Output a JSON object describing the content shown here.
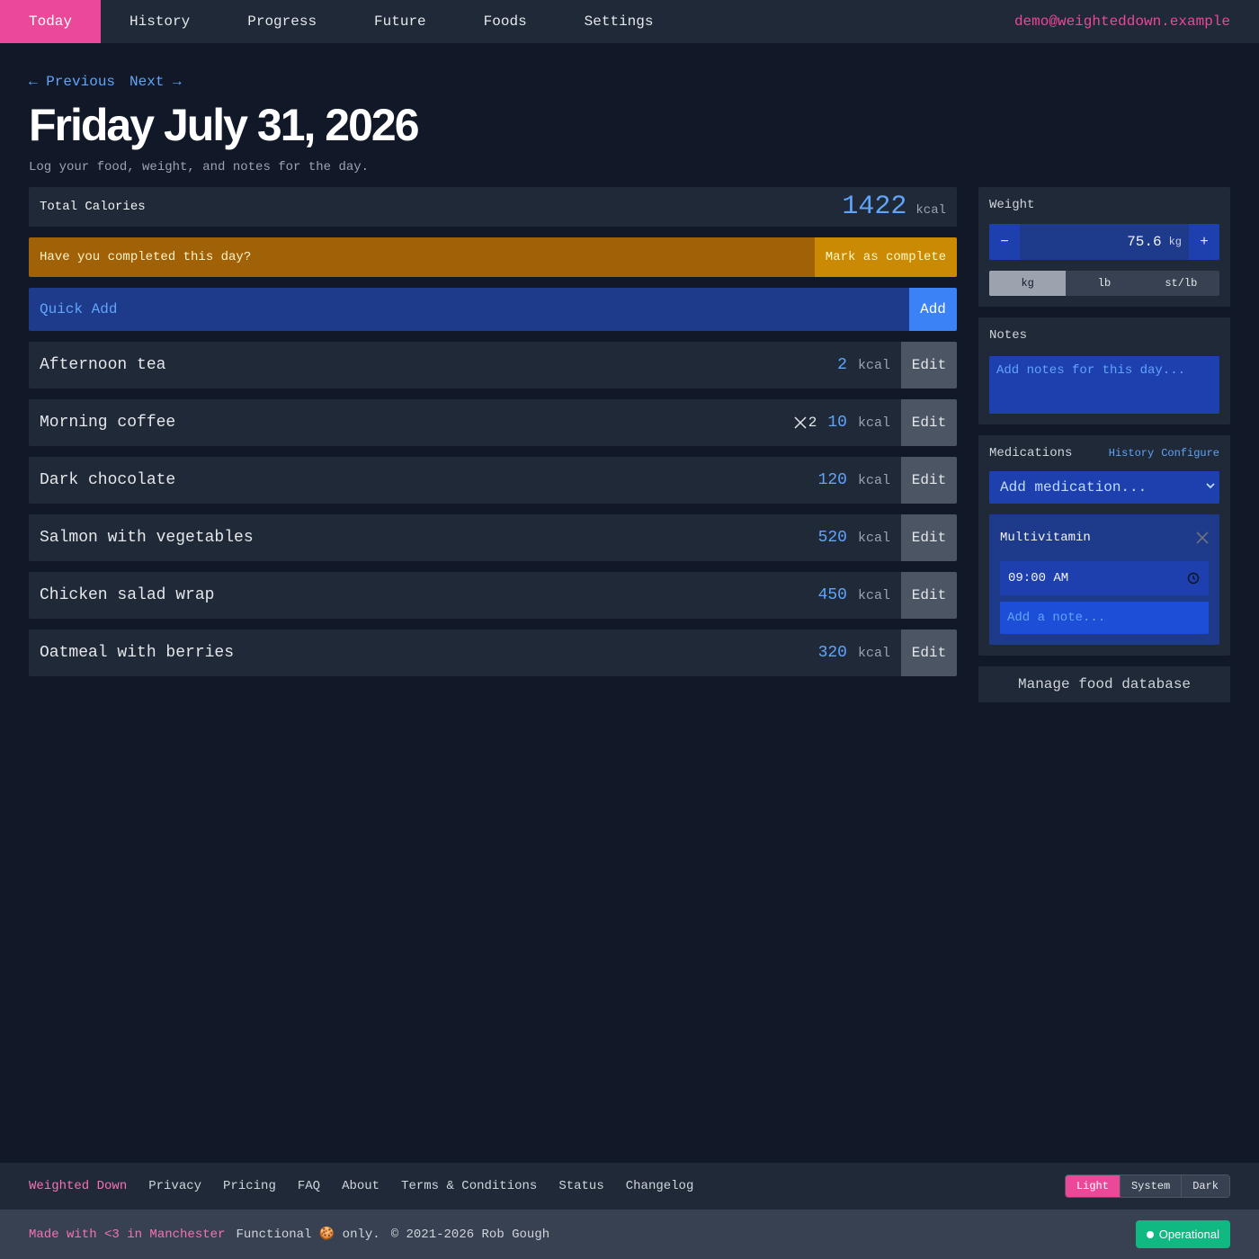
{
  "nav": {
    "items": [
      {
        "label": "Today",
        "active": true
      },
      {
        "label": "History",
        "active": false
      },
      {
        "label": "Progress",
        "active": false
      },
      {
        "label": "Future",
        "active": false
      },
      {
        "label": "Foods",
        "active": false
      },
      {
        "label": "Settings",
        "active": false
      }
    ],
    "user_email": "demo@weighteddown.example"
  },
  "date_nav": {
    "previous": "← Previous",
    "next": "Next →"
  },
  "page": {
    "title": "Friday July 31, 2026",
    "subtitle": "Log your food, weight, and notes for the day."
  },
  "total": {
    "label": "Total Calories",
    "value": "1422",
    "unit": "kcal"
  },
  "complete": {
    "question": "Have you completed this day?",
    "button": "Mark as complete"
  },
  "quick_add": {
    "placeholder": "Quick Add",
    "button": "Add"
  },
  "foods": [
    {
      "name": "Afternoon tea",
      "quantity": "",
      "kcal": "2",
      "unit": "kcal",
      "edit": "Edit"
    },
    {
      "name": "Morning coffee",
      "quantity": "2",
      "kcal": "10",
      "unit": "kcal",
      "edit": "Edit"
    },
    {
      "name": "Dark chocolate",
      "quantity": "",
      "kcal": "120",
      "unit": "kcal",
      "edit": "Edit"
    },
    {
      "name": "Salmon with vegetables",
      "quantity": "",
      "kcal": "520",
      "unit": "kcal",
      "edit": "Edit"
    },
    {
      "name": "Chicken salad wrap",
      "quantity": "",
      "kcal": "450",
      "unit": "kcal",
      "edit": "Edit"
    },
    {
      "name": "Oatmeal with berries",
      "quantity": "",
      "kcal": "320",
      "unit": "kcal",
      "edit": "Edit"
    }
  ],
  "weight": {
    "title": "Weight",
    "minus": "−",
    "plus": "+",
    "value": "75.6",
    "unit": "kg",
    "units": [
      {
        "label": "kg",
        "active": true
      },
      {
        "label": "lb",
        "active": false
      },
      {
        "label": "st/lb",
        "active": false
      }
    ]
  },
  "notes": {
    "title": "Notes",
    "placeholder": "Add notes for this day..."
  },
  "medications": {
    "title": "Medications",
    "history_link": "History",
    "configure_link": "Configure",
    "select_placeholder": "Add medication...",
    "items": [
      {
        "name": "Multivitamin",
        "time": "09:00 AM",
        "note_placeholder": "Add a note..."
      }
    ]
  },
  "manage_button": "Manage food database",
  "footer": {
    "brand": "Weighted Down",
    "links": [
      "Privacy",
      "Pricing",
      "FAQ",
      "About",
      "Terms & Conditions",
      "Status",
      "Changelog"
    ],
    "theme_options": [
      {
        "label": "Light",
        "active": true
      },
      {
        "label": "System",
        "active": false
      },
      {
        "label": "Dark",
        "active": false
      }
    ],
    "made_with": "Made with <3 in Manchester",
    "functional": "Functional 🍪 only.",
    "copyright": "© 2021-2026 Rob Gough",
    "status": "Operational"
  },
  "colors": {
    "accent_pink": "#ec4899",
    "link_blue": "#60a5fa",
    "background": "#111827",
    "panel": "#1f2937",
    "status_green": "#10b981"
  }
}
